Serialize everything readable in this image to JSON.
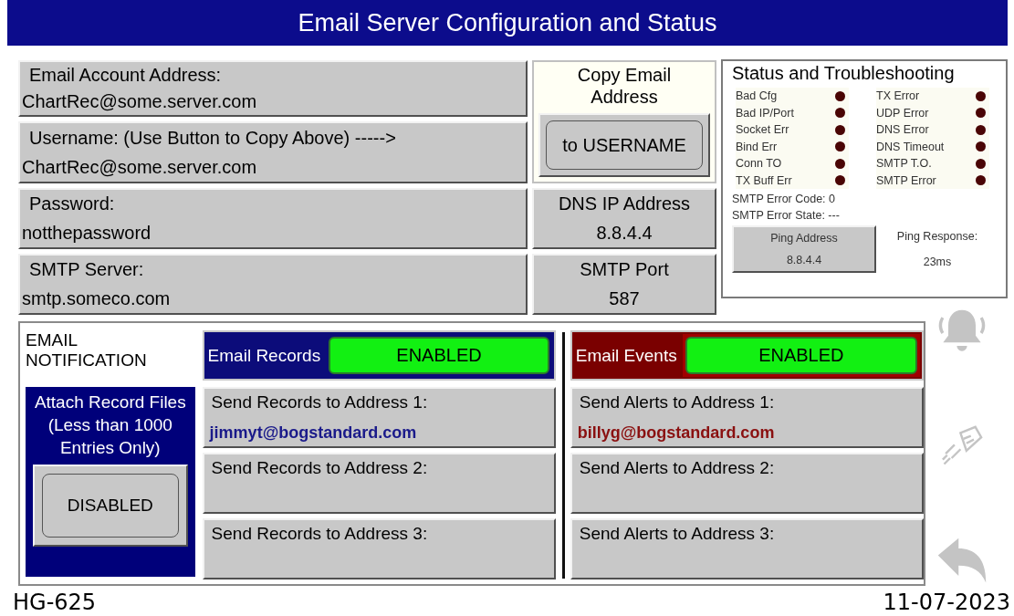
{
  "title": "Email Server Configuration and Status",
  "account_fields": [
    {
      "label": "Email Account Address:",
      "value": "ChartRec@some.server.com"
    },
    {
      "label": "Username: (Use Button to Copy Above) ----->",
      "value": "ChartRec@some.server.com"
    },
    {
      "label": "Password:",
      "value": "notthepassword"
    },
    {
      "label": "SMTP Server:",
      "value": "smtp.someco.com"
    }
  ],
  "copy_email": {
    "label": "Copy Email Address",
    "button": "to USERNAME"
  },
  "dns": {
    "label": "DNS IP Address",
    "value": "8.8.4.4"
  },
  "smtp_port": {
    "label": "SMTP Port",
    "value": "587"
  },
  "status": {
    "title": "Status and Troubleshooting",
    "indicators": [
      {
        "label": "Bad Cfg",
        "on": false
      },
      {
        "label": "Bad IP/Port",
        "on": false
      },
      {
        "label": "Socket Err",
        "on": false
      },
      {
        "label": "Bind Err",
        "on": false
      },
      {
        "label": "Conn TO",
        "on": false
      },
      {
        "label": "TX Buff Err",
        "on": false
      },
      {
        "label": "TX Error",
        "on": false
      },
      {
        "label": "UDP Error",
        "on": false
      },
      {
        "label": "DNS Error",
        "on": false
      },
      {
        "label": "DNS Timeout",
        "on": false
      },
      {
        "label": "SMTP T.O.",
        "on": false
      },
      {
        "label": "SMTP Error",
        "on": false
      }
    ],
    "error_code": "SMTP Error Code: 0",
    "error_state": "SMTP Error State: ---",
    "ping_button": {
      "label": "Ping Address",
      "value": "8.8.4.4"
    },
    "ping_response": {
      "label": "Ping Response:",
      "value": "23ms"
    }
  },
  "notification": {
    "heading": "EMAIL NOTIFICATION",
    "attach": {
      "label": "Attach Record Files (Less than 1000 Entries Only)",
      "button": "DISABLED",
      "enabled": false
    },
    "groups": [
      {
        "kind": "records",
        "title": "Email Records",
        "toggle": "ENABLED",
        "enabled": true,
        "addresses": [
          {
            "label": "Send Records to Address 1:",
            "value": "jimmyt@bogstandard.com"
          },
          {
            "label": "Send Records to Address 2:"
          },
          {
            "label": "Send Records to Address 3:"
          }
        ]
      },
      {
        "kind": "events",
        "title": "Email Events",
        "toggle": "ENABLED",
        "enabled": true,
        "addresses": [
          {
            "label": "Send Alerts to Address 1:",
            "value": "billyg@bogstandard.com"
          },
          {
            "label": "Send Alerts to Address 2:"
          },
          {
            "label": "Send Alerts to Address 3:"
          }
        ]
      }
    ]
  },
  "footer": {
    "model": "HG-625",
    "date": "11-07-2023"
  }
}
